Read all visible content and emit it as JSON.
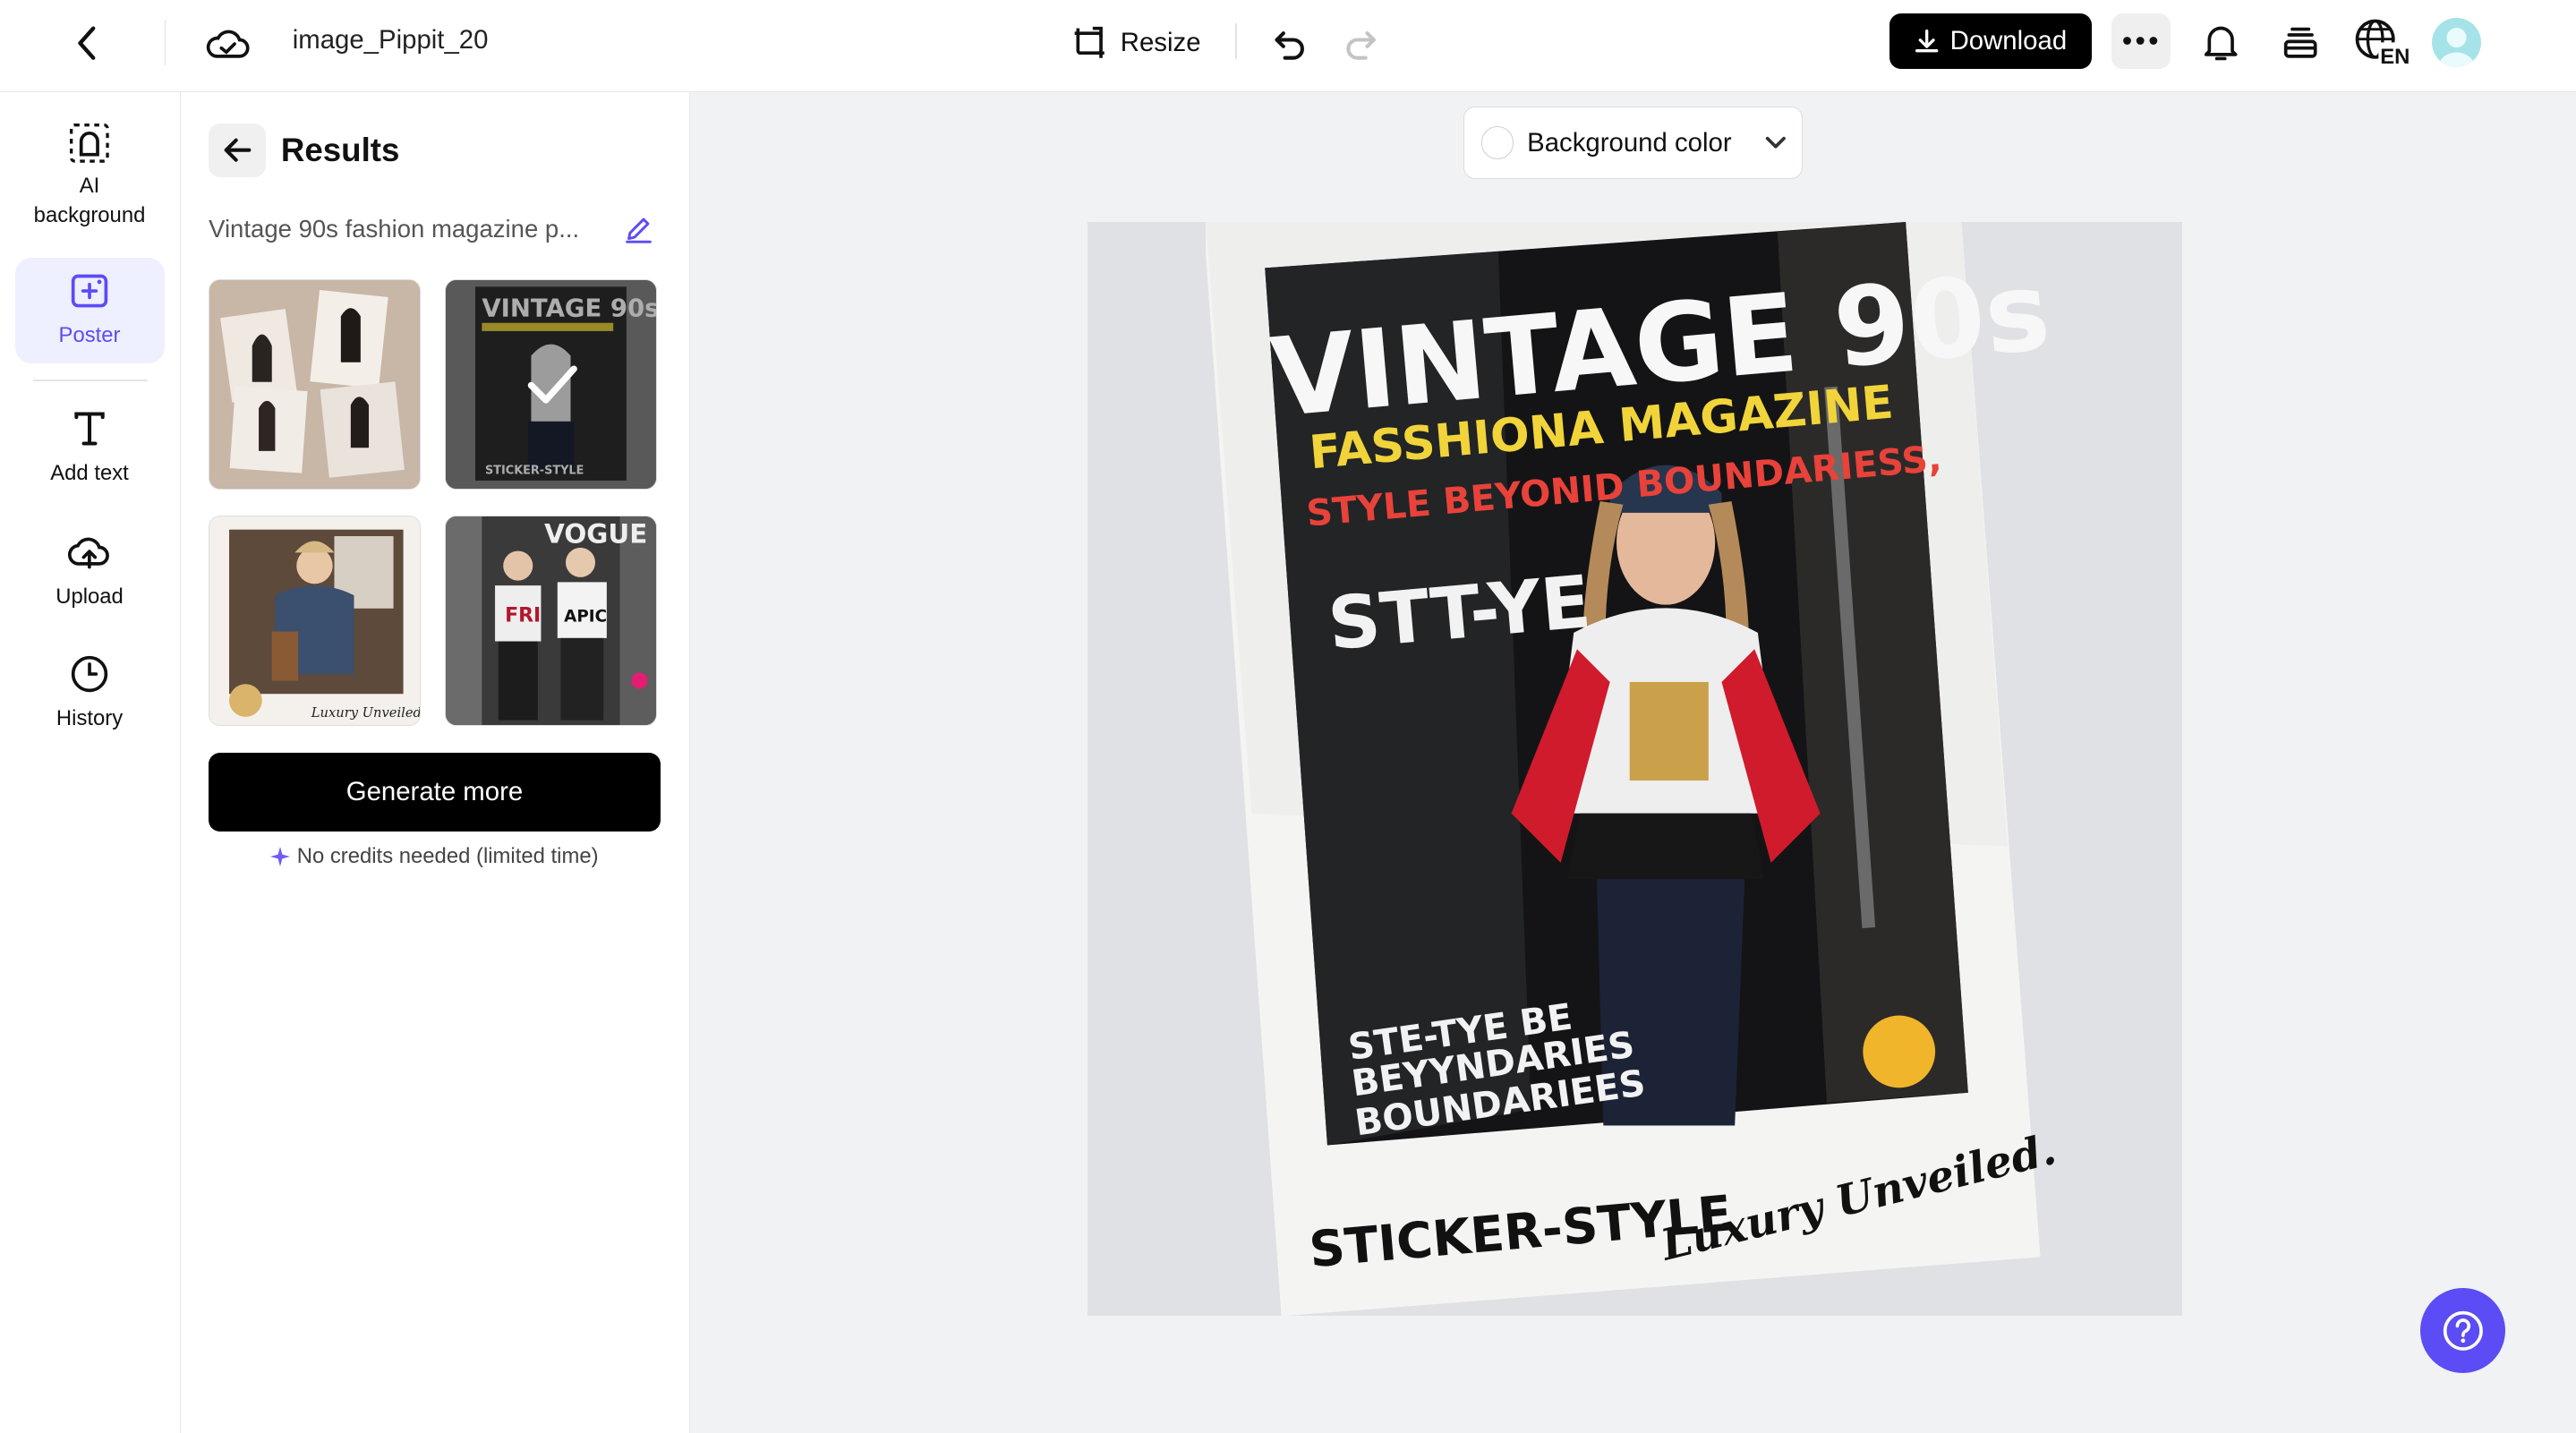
{
  "header": {
    "file_name": "image_Pippit_20",
    "resize_label": "Resize",
    "download_label": "Download",
    "language": "EN"
  },
  "rail": {
    "items": [
      {
        "label": "AI background",
        "icon": "ai-background-icon"
      },
      {
        "label": "Poster",
        "icon": "poster-icon",
        "active": true
      },
      {
        "label": "Add text",
        "icon": "text-icon"
      },
      {
        "label": "Upload",
        "icon": "cloud-upload-icon"
      },
      {
        "label": "History",
        "icon": "clock-icon"
      }
    ]
  },
  "panel": {
    "title": "Results",
    "prompt": "Vintage 90s fashion magazine p...",
    "generate_label": "Generate more",
    "credits_note": "No credits needed (limited time)",
    "selected_result": 2
  },
  "canvas": {
    "background_color_label": "Background color"
  },
  "poster": {
    "headline": "VINTAGE 90s",
    "subhead": "FASSHIONA MAGAZINE",
    "tagline": "STYLE BEYONID BOUNDARIESS,",
    "side_word": "STT-YE",
    "lower_text_1": "STE-TYE BE",
    "lower_text_2": "BEYYNDARIES",
    "lower_text_3": "BOUNDARIEES",
    "brand": "STICKER-STYLE",
    "script": "Luxury Unveiled."
  },
  "colors": {
    "accent": "#5b4cf5",
    "primary_button": "#000000",
    "active_bg": "#eeefff"
  }
}
